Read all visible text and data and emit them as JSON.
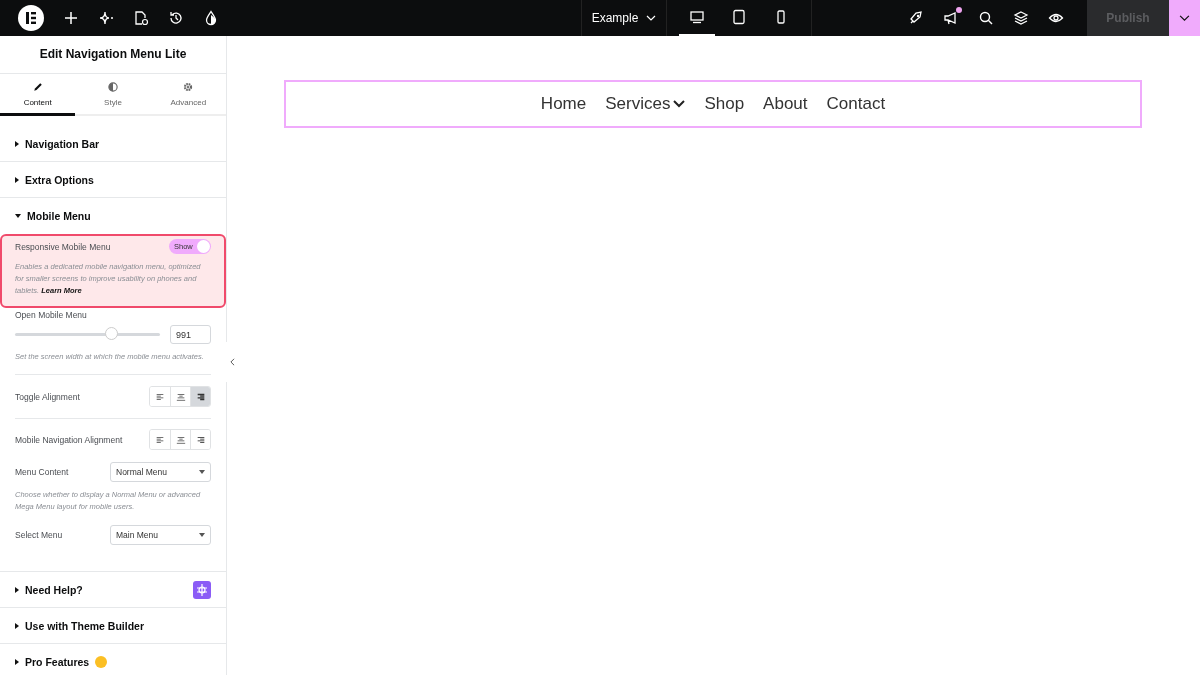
{
  "topbar": {
    "page_name": "Example",
    "devices": [
      {
        "selected": true
      },
      {
        "selected": false
      },
      {
        "selected": false
      }
    ],
    "notification": true,
    "publish": {
      "label": "Publish",
      "disabled": true
    }
  },
  "panel": {
    "title": "Edit Navigation Menu Lite",
    "tabs": [
      {
        "label": "Content",
        "selected": true
      },
      {
        "label": "Style",
        "selected": false
      },
      {
        "label": "Advanced",
        "selected": false
      }
    ],
    "sections_before": [
      {
        "title": "Navigation Bar",
        "expanded": false
      },
      {
        "title": "Extra Options",
        "expanded": false
      }
    ],
    "open_section": {
      "title": "Mobile Menu",
      "expanded": true
    },
    "controls": [
      {
        "kind": "toggle",
        "label": "Responsive Mobile Menu",
        "toggle_label": "Show",
        "on": true,
        "highlighted": true,
        "description": "Enables a dedicated mobile navigation menu, optimized for smaller screens to improve usability on phones and tablets.",
        "link": "Learn More"
      },
      {
        "kind": "slider",
        "label": "Open Mobile Menu",
        "level": 0.66,
        "value": "991",
        "description": "Set the screen width at which the mobile menu activates."
      },
      {
        "kind": "choose",
        "label": "Toggle Alignment",
        "options": [
          {
            "selected": false
          },
          {
            "selected": false
          },
          {
            "selected": true
          }
        ]
      },
      {
        "kind": "choose",
        "label": "Mobile Navigation Alignment",
        "options": [
          {
            "selected": false
          },
          {
            "selected": false
          },
          {
            "selected": false
          }
        ]
      },
      {
        "kind": "select",
        "label": "Menu Content",
        "value": "Normal Menu",
        "description": "Choose whether to display a Normal Menu or advanced Mega Menu layout for mobile users."
      },
      {
        "kind": "select",
        "label": "Select Menu",
        "value": "Main Menu"
      }
    ],
    "sections_after": [
      {
        "title": "Need Help?",
        "expanded": false,
        "kind": "help"
      },
      {
        "title": "Use with Theme Builder",
        "expanded": false
      },
      {
        "title": "Pro Features",
        "expanded": false,
        "kind": "pro"
      }
    ]
  },
  "canvas": {
    "nav_items": [
      {
        "label": "Home",
        "has_dropdown": false
      },
      {
        "label": "Services",
        "has_dropdown": true
      },
      {
        "label": "Shop",
        "has_dropdown": false
      },
      {
        "label": "About",
        "has_dropdown": false
      },
      {
        "label": "Contact",
        "has_dropdown": false
      }
    ]
  }
}
